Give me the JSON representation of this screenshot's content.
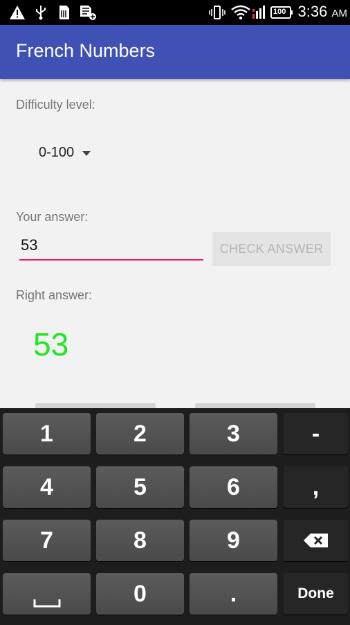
{
  "status_bar": {
    "time": "3:36",
    "ampm": "AM",
    "battery": "100",
    "icons": [
      "warning-icon",
      "usb-icon",
      "sim-card-icon",
      "sd-card-icon",
      "vibrate-icon",
      "wifi-icon",
      "signal-icon",
      "battery-icon"
    ]
  },
  "app_bar": {
    "title": "French Numbers"
  },
  "difficulty": {
    "label": "Difficulty level:",
    "selected": "0-100"
  },
  "answer": {
    "label": "Your answer:",
    "value": "53",
    "check_button": "CHECK ANSWER"
  },
  "right_answer": {
    "label": "Right answer:",
    "value": "53",
    "color": "#22e622"
  },
  "accent_color": "#e91e63",
  "app_bar_color": "#3f51b5",
  "keyboard": {
    "keys": [
      "1",
      "2",
      "3",
      "-",
      "4",
      "5",
      "6",
      ",",
      "7",
      "8",
      "9",
      "␣",
      "0",
      ".",
      "Done"
    ],
    "backspace_icon": "backspace-icon",
    "space_icon": "space-icon"
  }
}
